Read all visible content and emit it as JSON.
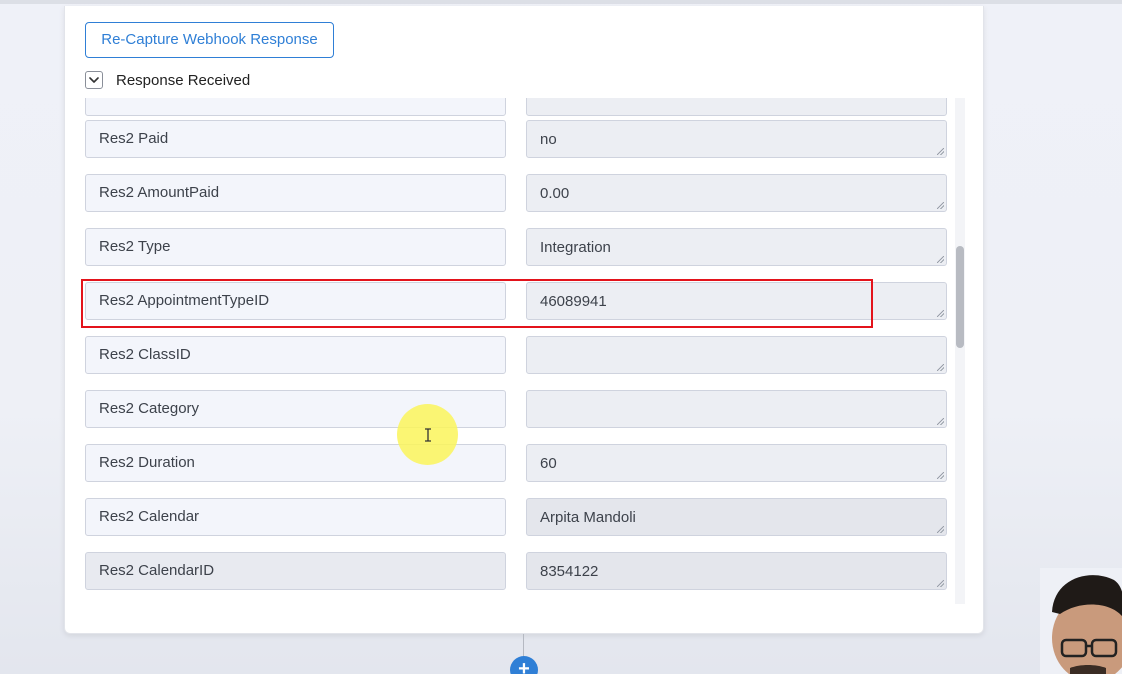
{
  "header": {
    "recapture_label": "Re-Capture Webhook Response",
    "response_toggle_label": "Response Received",
    "response_toggle_expanded": true
  },
  "fields": [
    {
      "key": "",
      "value": ""
    },
    {
      "key": "Res2 Paid",
      "value": "no"
    },
    {
      "key": "Res2 AmountPaid",
      "value": "0.00"
    },
    {
      "key": "Res2 Type",
      "value": "Integration"
    },
    {
      "key": "Res2 AppointmentTypeID",
      "value": "46089941",
      "highlighted": true
    },
    {
      "key": "Res2 ClassID",
      "value": ""
    },
    {
      "key": "Res2 Category",
      "value": ""
    },
    {
      "key": "Res2 Duration",
      "value": "60"
    },
    {
      "key": "Res2 Calendar",
      "value": "Arpita Mandoli"
    },
    {
      "key": "Res2 CalendarID",
      "value": "8354122"
    }
  ],
  "add_step": {
    "label": "+"
  },
  "colors": {
    "accent": "#2f7fd6",
    "highlight": "#e3131b",
    "cursor_halo": "#faf55a"
  },
  "icons": {
    "toggle": "chevron-down-icon",
    "cursor": "text-cursor-icon",
    "add": "plus-icon"
  }
}
